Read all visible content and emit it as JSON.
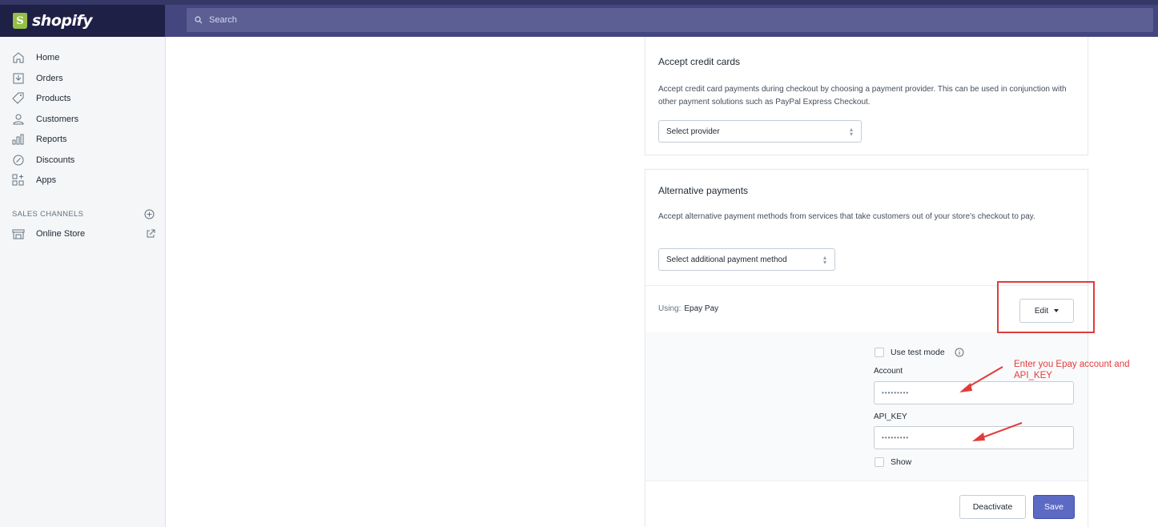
{
  "topbar": {
    "brand": "shopify",
    "brand_initial": "S",
    "search_placeholder": "Search"
  },
  "sidebar": {
    "items": [
      {
        "label": "Home",
        "icon": "home-icon"
      },
      {
        "label": "Orders",
        "icon": "orders-icon"
      },
      {
        "label": "Products",
        "icon": "tag-icon"
      },
      {
        "label": "Customers",
        "icon": "person-icon"
      },
      {
        "label": "Reports",
        "icon": "bar-chart-icon"
      },
      {
        "label": "Discounts",
        "icon": "discount-icon"
      },
      {
        "label": "Apps",
        "icon": "apps-icon"
      }
    ],
    "sales_channels_label": "SALES CHANNELS",
    "online_store_label": "Online Store"
  },
  "credit_cards": {
    "title": "Accept credit cards",
    "description": "Accept credit card payments during checkout by choosing a payment provider. This can be used in conjunction with other payment solutions such as PayPal Express Checkout.",
    "select_value": "Select provider"
  },
  "alternative": {
    "title": "Alternative payments",
    "description": "Accept alternative payment methods from services that take customers out of your store's checkout to pay.",
    "select_value": "Select additional payment method",
    "using_label": "Using:",
    "using_name": "Epay Pay",
    "edit_label": "Edit",
    "test_mode_label": "Use test mode",
    "account_label": "Account",
    "account_value": "•••••••••",
    "api_key_label": "API_KEY",
    "api_key_value": "•••••••••",
    "show_label": "Show",
    "deactivate_label": "Deactivate",
    "save_label": "Save"
  },
  "annotation": {
    "text": "Enter you Epay account and API_KEY",
    "color": "#e23b3b"
  },
  "colors": {
    "topbar": "#43467f",
    "logo_bg": "#1e2046",
    "primary_button": "#5c6ac4",
    "brand_green": "#95bf47"
  }
}
